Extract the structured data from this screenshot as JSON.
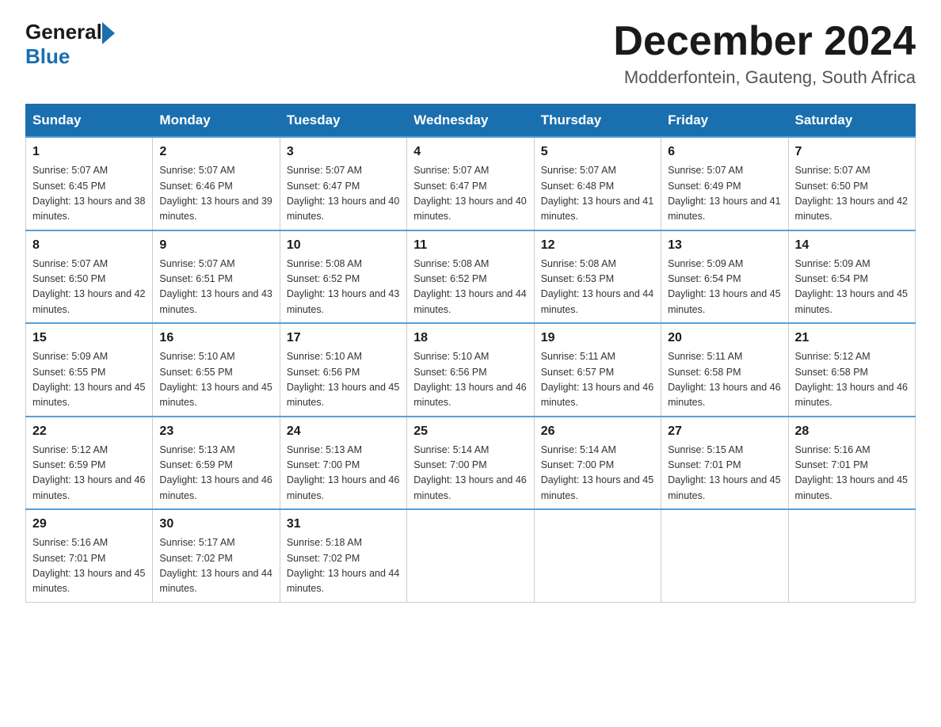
{
  "header": {
    "logo_general": "General",
    "logo_blue": "Blue",
    "month_title": "December 2024",
    "location": "Modderfontein, Gauteng, South Africa"
  },
  "days_of_week": [
    "Sunday",
    "Monday",
    "Tuesday",
    "Wednesday",
    "Thursday",
    "Friday",
    "Saturday"
  ],
  "weeks": [
    [
      {
        "day": "1",
        "sunrise": "Sunrise: 5:07 AM",
        "sunset": "Sunset: 6:45 PM",
        "daylight": "Daylight: 13 hours and 38 minutes."
      },
      {
        "day": "2",
        "sunrise": "Sunrise: 5:07 AM",
        "sunset": "Sunset: 6:46 PM",
        "daylight": "Daylight: 13 hours and 39 minutes."
      },
      {
        "day": "3",
        "sunrise": "Sunrise: 5:07 AM",
        "sunset": "Sunset: 6:47 PM",
        "daylight": "Daylight: 13 hours and 40 minutes."
      },
      {
        "day": "4",
        "sunrise": "Sunrise: 5:07 AM",
        "sunset": "Sunset: 6:47 PM",
        "daylight": "Daylight: 13 hours and 40 minutes."
      },
      {
        "day": "5",
        "sunrise": "Sunrise: 5:07 AM",
        "sunset": "Sunset: 6:48 PM",
        "daylight": "Daylight: 13 hours and 41 minutes."
      },
      {
        "day": "6",
        "sunrise": "Sunrise: 5:07 AM",
        "sunset": "Sunset: 6:49 PM",
        "daylight": "Daylight: 13 hours and 41 minutes."
      },
      {
        "day": "7",
        "sunrise": "Sunrise: 5:07 AM",
        "sunset": "Sunset: 6:50 PM",
        "daylight": "Daylight: 13 hours and 42 minutes."
      }
    ],
    [
      {
        "day": "8",
        "sunrise": "Sunrise: 5:07 AM",
        "sunset": "Sunset: 6:50 PM",
        "daylight": "Daylight: 13 hours and 42 minutes."
      },
      {
        "day": "9",
        "sunrise": "Sunrise: 5:07 AM",
        "sunset": "Sunset: 6:51 PM",
        "daylight": "Daylight: 13 hours and 43 minutes."
      },
      {
        "day": "10",
        "sunrise": "Sunrise: 5:08 AM",
        "sunset": "Sunset: 6:52 PM",
        "daylight": "Daylight: 13 hours and 43 minutes."
      },
      {
        "day": "11",
        "sunrise": "Sunrise: 5:08 AM",
        "sunset": "Sunset: 6:52 PM",
        "daylight": "Daylight: 13 hours and 44 minutes."
      },
      {
        "day": "12",
        "sunrise": "Sunrise: 5:08 AM",
        "sunset": "Sunset: 6:53 PM",
        "daylight": "Daylight: 13 hours and 44 minutes."
      },
      {
        "day": "13",
        "sunrise": "Sunrise: 5:09 AM",
        "sunset": "Sunset: 6:54 PM",
        "daylight": "Daylight: 13 hours and 45 minutes."
      },
      {
        "day": "14",
        "sunrise": "Sunrise: 5:09 AM",
        "sunset": "Sunset: 6:54 PM",
        "daylight": "Daylight: 13 hours and 45 minutes."
      }
    ],
    [
      {
        "day": "15",
        "sunrise": "Sunrise: 5:09 AM",
        "sunset": "Sunset: 6:55 PM",
        "daylight": "Daylight: 13 hours and 45 minutes."
      },
      {
        "day": "16",
        "sunrise": "Sunrise: 5:10 AM",
        "sunset": "Sunset: 6:55 PM",
        "daylight": "Daylight: 13 hours and 45 minutes."
      },
      {
        "day": "17",
        "sunrise": "Sunrise: 5:10 AM",
        "sunset": "Sunset: 6:56 PM",
        "daylight": "Daylight: 13 hours and 45 minutes."
      },
      {
        "day": "18",
        "sunrise": "Sunrise: 5:10 AM",
        "sunset": "Sunset: 6:56 PM",
        "daylight": "Daylight: 13 hours and 46 minutes."
      },
      {
        "day": "19",
        "sunrise": "Sunrise: 5:11 AM",
        "sunset": "Sunset: 6:57 PM",
        "daylight": "Daylight: 13 hours and 46 minutes."
      },
      {
        "day": "20",
        "sunrise": "Sunrise: 5:11 AM",
        "sunset": "Sunset: 6:58 PM",
        "daylight": "Daylight: 13 hours and 46 minutes."
      },
      {
        "day": "21",
        "sunrise": "Sunrise: 5:12 AM",
        "sunset": "Sunset: 6:58 PM",
        "daylight": "Daylight: 13 hours and 46 minutes."
      }
    ],
    [
      {
        "day": "22",
        "sunrise": "Sunrise: 5:12 AM",
        "sunset": "Sunset: 6:59 PM",
        "daylight": "Daylight: 13 hours and 46 minutes."
      },
      {
        "day": "23",
        "sunrise": "Sunrise: 5:13 AM",
        "sunset": "Sunset: 6:59 PM",
        "daylight": "Daylight: 13 hours and 46 minutes."
      },
      {
        "day": "24",
        "sunrise": "Sunrise: 5:13 AM",
        "sunset": "Sunset: 7:00 PM",
        "daylight": "Daylight: 13 hours and 46 minutes."
      },
      {
        "day": "25",
        "sunrise": "Sunrise: 5:14 AM",
        "sunset": "Sunset: 7:00 PM",
        "daylight": "Daylight: 13 hours and 46 minutes."
      },
      {
        "day": "26",
        "sunrise": "Sunrise: 5:14 AM",
        "sunset": "Sunset: 7:00 PM",
        "daylight": "Daylight: 13 hours and 45 minutes."
      },
      {
        "day": "27",
        "sunrise": "Sunrise: 5:15 AM",
        "sunset": "Sunset: 7:01 PM",
        "daylight": "Daylight: 13 hours and 45 minutes."
      },
      {
        "day": "28",
        "sunrise": "Sunrise: 5:16 AM",
        "sunset": "Sunset: 7:01 PM",
        "daylight": "Daylight: 13 hours and 45 minutes."
      }
    ],
    [
      {
        "day": "29",
        "sunrise": "Sunrise: 5:16 AM",
        "sunset": "Sunset: 7:01 PM",
        "daylight": "Daylight: 13 hours and 45 minutes."
      },
      {
        "day": "30",
        "sunrise": "Sunrise: 5:17 AM",
        "sunset": "Sunset: 7:02 PM",
        "daylight": "Daylight: 13 hours and 44 minutes."
      },
      {
        "day": "31",
        "sunrise": "Sunrise: 5:18 AM",
        "sunset": "Sunset: 7:02 PM",
        "daylight": "Daylight: 13 hours and 44 minutes."
      },
      null,
      null,
      null,
      null
    ]
  ]
}
